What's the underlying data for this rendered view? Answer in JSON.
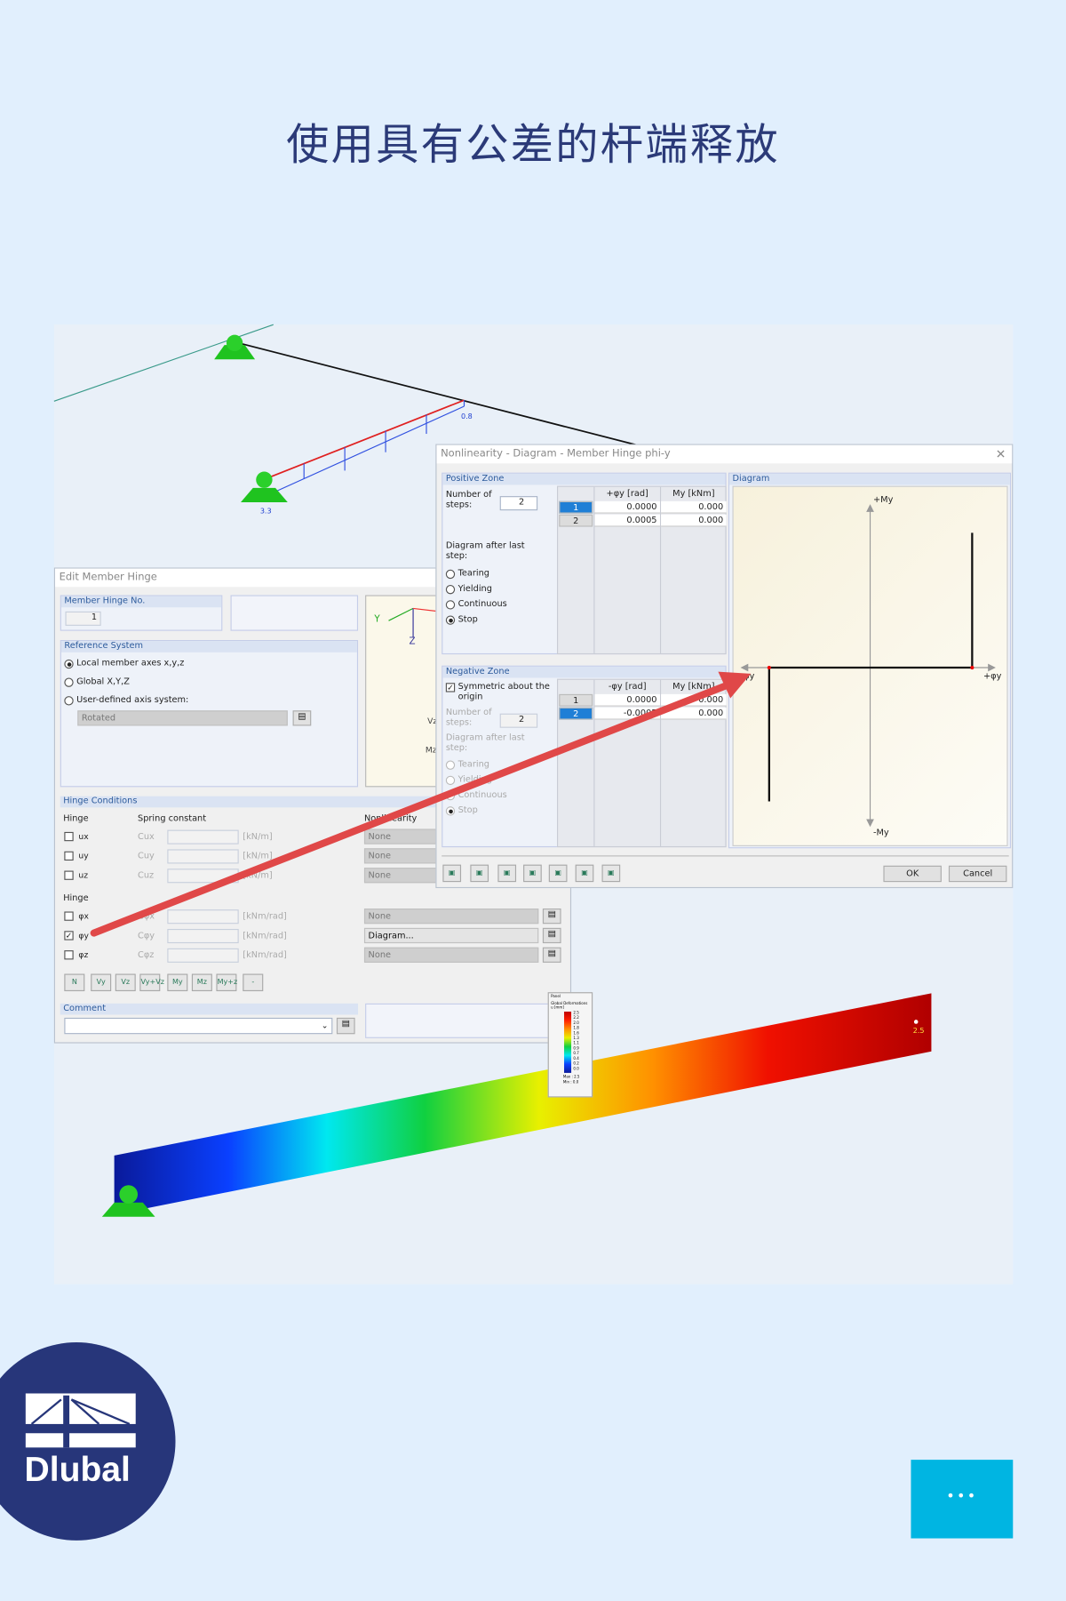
{
  "page": {
    "title": "使用具有公差的杆端释放"
  },
  "scene": {
    "load_label_right": "0.8",
    "load_label_left": "3.3",
    "beam_label": "2.5"
  },
  "edit_dialog": {
    "title": "Edit Member Hinge",
    "hinge_no_header": "Member Hinge No.",
    "hinge_no": "1",
    "reference_header": "Reference System",
    "ref_options": [
      "Local member axes x,y,z",
      "Global X,Y,Z",
      "User-defined axis system:"
    ],
    "ref_selected": 0,
    "axis_dropdown": "Rotated",
    "preview_labels": {
      "y": "Y",
      "z": "Z",
      "vz": "Vz",
      "mz": "Mz"
    },
    "conditions_header": "Hinge Conditions",
    "col_hinge": "Hinge",
    "col_spring": "Spring constant",
    "col_nonlinearity": "Nonlinearity",
    "translation_rows": [
      {
        "label": "ux",
        "const": "Cux",
        "unit": "[kN/m]",
        "nonlinearity": "None",
        "checked": false
      },
      {
        "label": "uy",
        "const": "Cuy",
        "unit": "[kN/m]",
        "nonlinearity": "None",
        "checked": false
      },
      {
        "label": "uz",
        "const": "Cuz",
        "unit": "[kN/m]",
        "nonlinearity": "None",
        "checked": false
      }
    ],
    "rotation_header": "Hinge",
    "rotation_rows": [
      {
        "label": "φx",
        "const": "Cφx",
        "unit": "[kNm/rad]",
        "nonlinearity": "None",
        "checked": false
      },
      {
        "label": "φy",
        "const": "Cφy",
        "unit": "[kNm/rad]",
        "nonlinearity": "Diagram...",
        "checked": true
      },
      {
        "label": "φz",
        "const": "Cφz",
        "unit": "[kNm/rad]",
        "nonlinearity": "None",
        "checked": false
      }
    ],
    "toolbar": [
      "N",
      "Vy",
      "Vz",
      "Vy+Vz",
      "My",
      "Mz",
      "My+z",
      "-"
    ],
    "comment_header": "Comment",
    "comment_value": ""
  },
  "nl_dialog": {
    "title": "Nonlinearity - Diagram - Member Hinge phi-y",
    "positive": {
      "header": "Positive Zone",
      "steps_label": "Number of steps:",
      "steps": "2",
      "after_label": "Diagram after last step:",
      "options": [
        "Tearing",
        "Yielding",
        "Continuous",
        "Stop"
      ],
      "selected": 3,
      "col_phi": "+φy [rad]",
      "col_m": "My [kNm]",
      "rows": [
        {
          "n": "1",
          "phi": "0.0000",
          "m": "0.000"
        },
        {
          "n": "2",
          "phi": "0.0005",
          "m": "0.000"
        }
      ]
    },
    "negative": {
      "header": "Negative Zone",
      "symmetric_label": "Symmetric about the origin",
      "symmetric": true,
      "steps_label": "Number of steps:",
      "steps": "2",
      "after_label": "Diagram after last step:",
      "options": [
        "Tearing",
        "Yielding",
        "Continuous",
        "Stop"
      ],
      "selected": 3,
      "col_phi": "-φy [rad]",
      "col_m": "My [kNm]",
      "rows": [
        {
          "n": "1",
          "phi": "0.0000",
          "m": "0.000"
        },
        {
          "n": "2",
          "phi": "-0.0005",
          "m": "0.000"
        }
      ]
    },
    "diagram": {
      "header": "Diagram",
      "pos_m": "+My",
      "neg_m": "-My",
      "neg_phi": "-φy",
      "pos_phi": "+φy"
    },
    "ok": "OK",
    "cancel": "Cancel"
  },
  "panel": {
    "title": "Panel",
    "subtitle": "Global Deformations",
    "unit": "u [mm]",
    "scale": [
      "2.5",
      "2.2",
      "2.0",
      "1.8",
      "1.6",
      "1.3",
      "1.1",
      "0.9",
      "0.7",
      "0.4",
      "0.2",
      "0.0"
    ],
    "max": "Max : 2.5",
    "min": "Min : 0.0"
  },
  "brand": {
    "logo_text": "Dlubal",
    "navy": "#27367a",
    "accent": "#00b5e2",
    "arrow": "#e04848"
  },
  "more_button": {
    "label": "•••"
  }
}
